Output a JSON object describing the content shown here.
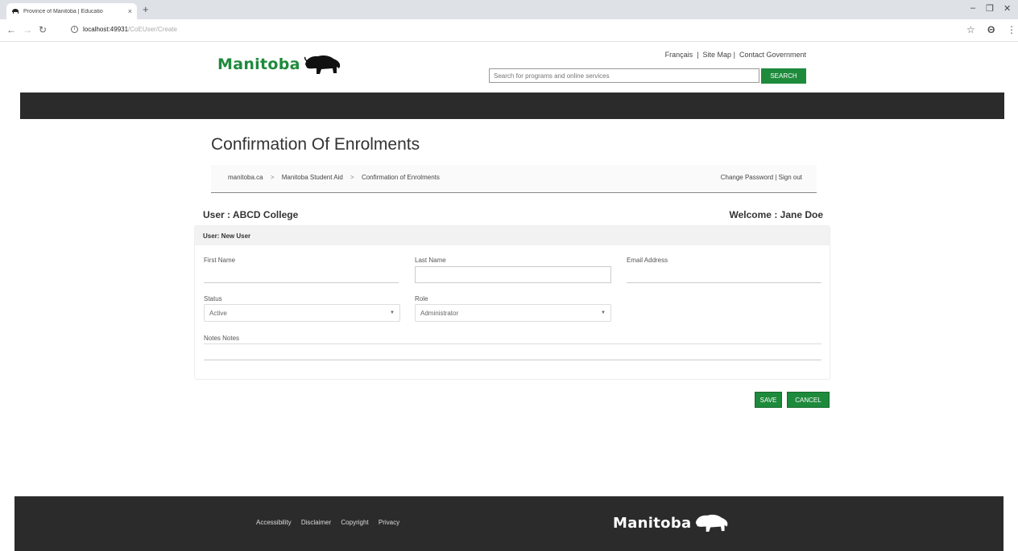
{
  "browser": {
    "tab_title": "Province of Manitoba | Educatio",
    "tab_close": "×",
    "new_tab": "+",
    "url_host": "localhost:49931",
    "url_path": "/CoEUser/Create",
    "window_controls": {
      "minimize": "–",
      "restore": "❐",
      "close": "✕"
    }
  },
  "header": {
    "logo_text": "Manitoba",
    "top_links": [
      "Français",
      "Site Map",
      "Contact Government"
    ],
    "search": {
      "placeholder": "Search for programs and online services",
      "button_label": "SEARCH"
    }
  },
  "page": {
    "title": "Confirmation Of Enrolments",
    "breadcrumb": [
      "manitoba.ca",
      "Manitoba Student Aid",
      "Confirmation of Enrolments"
    ],
    "breadcrumb_separator": ">",
    "account_links": [
      "Change Password",
      "Sign out"
    ],
    "user_label": "User : ABCD College",
    "welcome_label": "Welcome : Jane Doe"
  },
  "form": {
    "panel_title": "User: New User",
    "fields": {
      "first_name": {
        "label": "First Name",
        "value": ""
      },
      "last_name": {
        "label": "Last Name",
        "value": ""
      },
      "email": {
        "label": "Email Address",
        "value": ""
      },
      "status": {
        "label": "Status",
        "value": "Active"
      },
      "role": {
        "label": "Role",
        "value": "Administrator"
      },
      "notes": {
        "label": "Notes Notes",
        "value": ""
      }
    },
    "buttons": {
      "save": "SAVE",
      "cancel": "CANCEL"
    }
  },
  "footer": {
    "links": [
      "Accessibility",
      "Disclaimer",
      "Copyright",
      "Privacy"
    ],
    "logo_text": "Manitoba"
  },
  "colors": {
    "brand_green": "#1e8a3c",
    "dark_band": "#2b2b2b"
  },
  "icons": [
    "bison-icon",
    "back-icon",
    "forward-icon",
    "reload-icon",
    "info-icon",
    "star-icon",
    "profile-icon",
    "menu-icon",
    "caret-down-icon"
  ]
}
